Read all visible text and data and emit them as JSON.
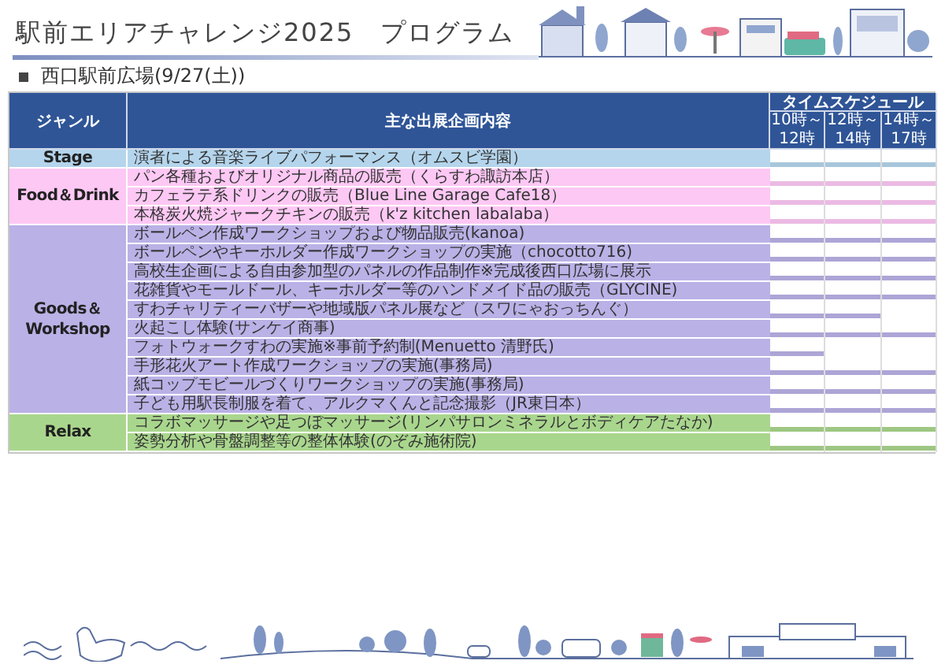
{
  "title": "駅前エリアチャレンジ2025　プログラム",
  "section": "西口駅前広場(9/27(土))",
  "table": {
    "genre_header": "ジャンル",
    "content_header": "主な出展企画内容",
    "schedule_header": "タイムスケジュール",
    "time_columns": [
      {
        "from": "10時～",
        "to": "12時"
      },
      {
        "from": "12時～",
        "to": "14時"
      },
      {
        "from": "14時～",
        "to": "17時"
      }
    ],
    "groups": [
      {
        "genre": "Stage",
        "color": "#b4d5ec",
        "rows": [
          {
            "content": "演者による音楽ライブパフォーマンス（オムスビ学園）",
            "slots": [
              true,
              true,
              true
            ]
          }
        ]
      },
      {
        "genre": "Food＆Drink",
        "color": "#fdc8f4",
        "rows": [
          {
            "content": "パン各種およびオリジナル商品の販売（くらすわ諏訪本店）",
            "slots": [
              true,
              true,
              true
            ]
          },
          {
            "content": "カフェラテ系ドリンクの販売（Blue Line Garage Cafe18）",
            "slots": [
              true,
              true,
              true
            ]
          },
          {
            "content": "本格炭火焼ジャークチキンの販売（k'z kitchen labalaba）",
            "slots": [
              true,
              true,
              true
            ]
          }
        ]
      },
      {
        "genre": "Goods＆ Workshop",
        "color": "#bab1e6",
        "rows": [
          {
            "content": "ボールペン作成ワークショップおよび物品販売(kanoa)",
            "slots": [
              true,
              true,
              true
            ]
          },
          {
            "content": "ボールペンやキーホルダー作成ワークショップの実施（chocotto716)",
            "slots": [
              true,
              true,
              true
            ]
          },
          {
            "content": "高校生企画による自由参加型のパネルの作品制作※完成後西口広場に展示",
            "slots": [
              true,
              true,
              true
            ]
          },
          {
            "content": "花雑貨やモールドール、キーホルダー等のハンドメイド品の販売（GLYCINE)",
            "slots": [
              true,
              true,
              true
            ]
          },
          {
            "content": "すわチャリティーバザーや地域版パネル展など（スワにゃおっちんぐ）",
            "slots": [
              true,
              true,
              false
            ]
          },
          {
            "content": "火起こし体験(サンケイ商事)",
            "slots": [
              true,
              true,
              true
            ]
          },
          {
            "content": "フォトウォークすわの実施※事前予約制(Menuetto 清野氏)",
            "slots": [
              true,
              false,
              false
            ]
          },
          {
            "content": "手形花火アート作成ワークショップの実施(事務局)",
            "slots": [
              true,
              true,
              true
            ]
          },
          {
            "content": "紙コップモビールづくりワークショップの実施(事務局)",
            "slots": [
              true,
              true,
              true
            ]
          },
          {
            "content": "子ども用駅長制服を着て、アルクマくんと記念撮影（JR東日本）",
            "slots": [
              true,
              true,
              true
            ]
          }
        ]
      },
      {
        "genre": "Relax",
        "color": "#a9d68d",
        "rows": [
          {
            "content": "コラボマッサージや足つぼマッサージ(リンパサロンミネラルとボディケアたなか)",
            "slots": [
              true,
              true,
              true
            ]
          },
          {
            "content": "姿勢分析や骨盤調整等の整体体験(のぞみ施術院)",
            "slots": [
              true,
              true,
              true
            ]
          }
        ]
      }
    ]
  }
}
